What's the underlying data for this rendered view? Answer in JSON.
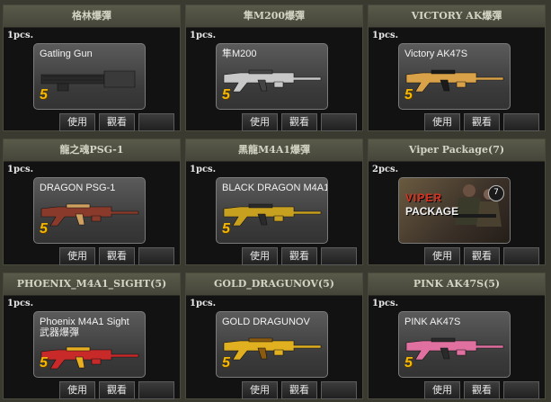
{
  "items": [
    {
      "title": "格林爆彈",
      "qty": "1pcs.",
      "card_name": "Gatling Gun",
      "card_sub": "",
      "level": "5",
      "use_label": "使用",
      "view_label": "觀看",
      "gun_color": "#2a2a2a",
      "accent": "#888888"
    },
    {
      "title": "隼M200爆彈",
      "qty": "1pcs.",
      "card_name": "隼M200",
      "card_sub": "",
      "level": "5",
      "use_label": "使用",
      "view_label": "觀看",
      "gun_color": "#c8c8c8",
      "accent": "#444444"
    },
    {
      "title": "VICTORY AK爆彈",
      "qty": "1pcs.",
      "card_name": "Victory AK47S",
      "card_sub": "",
      "level": "5",
      "use_label": "使用",
      "view_label": "觀看",
      "gun_color": "#d9a248",
      "accent": "#1a1a1a"
    },
    {
      "title": "龍之魂PSG-1",
      "qty": "1pcs.",
      "card_name": "DRAGON PSG-1",
      "card_sub": "",
      "level": "5",
      "use_label": "使用",
      "view_label": "觀看",
      "gun_color": "#8a3a2a",
      "accent": "#d0a060"
    },
    {
      "title": "黑龍M4A1爆彈",
      "qty": "1pcs.",
      "card_name": "BLACK DRAGON M4A1",
      "card_sub": "",
      "level": "5",
      "use_label": "使用",
      "view_label": "觀看",
      "gun_color": "#c8a020",
      "accent": "#2a2a2a"
    },
    {
      "title": "Viper Package(7)",
      "qty": "2pcs.",
      "card_name": "",
      "card_sub": "",
      "level": "",
      "use_label": "使用",
      "view_label": "觀看",
      "gun_color": "#555555",
      "accent": "#333333",
      "viper": {
        "title": "VIPER",
        "sub": "PACKAGE",
        "badge": "7"
      }
    },
    {
      "title": "PHOENIX_M4A1_SIGHT(5)",
      "qty": "1pcs.",
      "card_name": "Phoenix  M4A1 Sight",
      "card_sub": "武器爆彈",
      "level": "5",
      "use_label": "使用",
      "view_label": "觀看",
      "gun_color": "#c82a2a",
      "accent": "#e8b020"
    },
    {
      "title": "GOLD_DRAGUNOV(5)",
      "qty": "1pcs.",
      "card_name": "GOLD DRAGUNOV",
      "card_sub": "",
      "level": "5",
      "use_label": "使用",
      "view_label": "觀看",
      "gun_color": "#e0b020",
      "accent": "#8a5a10"
    },
    {
      "title": "PINK AK47S(5)",
      "qty": "1pcs.",
      "card_name": "PINK  AK47S",
      "card_sub": "",
      "level": "5",
      "use_label": "使用",
      "view_label": "觀看",
      "gun_color": "#e070a0",
      "accent": "#2a2a2a"
    }
  ]
}
